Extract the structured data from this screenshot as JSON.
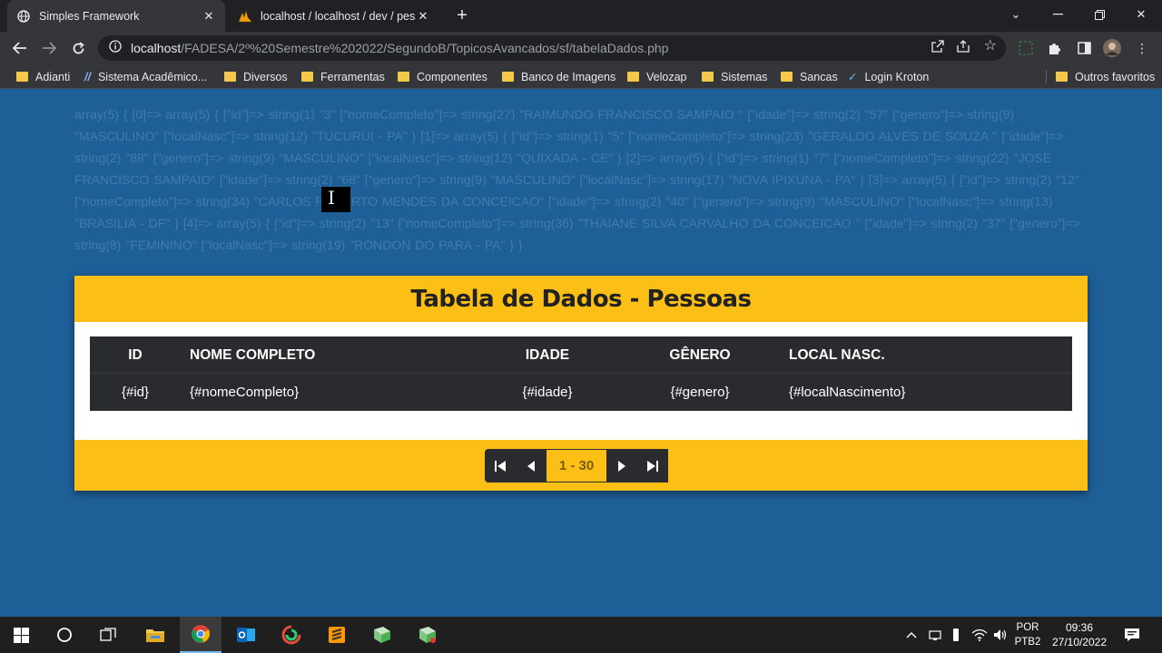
{
  "browser": {
    "tabs": [
      {
        "title": "Simples Framework",
        "icon": "globe-icon",
        "active": true
      },
      {
        "title": "localhost / localhost / dev / pessoas",
        "icon": "phpmyadmin-icon",
        "active": false
      }
    ],
    "url_host": "localhost",
    "url_path": "/FADESA/2º%20Semestre%202022/SegundoB/TopicosAvancados/sf/tabelaDados.php",
    "bookmarks": [
      {
        "label": "Adianti",
        "icon": "folder-icon"
      },
      {
        "label": "Sistema Acadêmico...",
        "icon": "slash-icon"
      },
      {
        "label": "Diversos",
        "icon": "folder-icon"
      },
      {
        "label": "Ferramentas",
        "icon": "folder-icon"
      },
      {
        "label": "Componentes",
        "icon": "folder-icon"
      },
      {
        "label": "Banco de Imagens",
        "icon": "folder-icon"
      },
      {
        "label": "Velozap",
        "icon": "folder-icon"
      },
      {
        "label": "Sistemas",
        "icon": "folder-icon"
      },
      {
        "label": "Sancas",
        "icon": "folder-icon"
      },
      {
        "label": "Login Kroton",
        "icon": "kroton-icon"
      }
    ],
    "other_bookmarks": "Outros favoritos"
  },
  "page": {
    "dump_text": "array(5) { [0]=> array(5) { [\"id\"]=> string(1) \"3\" [\"nomeCompleto\"]=> string(27) \"RAIMUNDO FRANCISCO SAMPAIO \" [\"idade\"]=> string(2) \"57\" [\"genero\"]=> string(9) \"MASCULINO\" [\"localNasc\"]=> string(12) \"TUCURUI - PA\" } [1]=> array(5) { [\"id\"]=> string(1) \"5\" [\"nomeCompleto\"]=> string(23) \"GERALDO ALVES DE SOUZA \" [\"idade\"]=> string(2) \"88\" [\"genero\"]=> string(9) \"MASCULINO\" [\"localNasc\"]=> string(12) \"QUIXADA - CE\" } [2]=> array(5) { [\"id\"]=> string(1) \"7\" [\"nomeCompleto\"]=> string(22) \"JOSE FRANCISCO SAMPAIO\" [\"idade\"]=> string(2) \"68\" [\"genero\"]=> string(9) \"MASCULINO\" [\"localNasc\"]=> string(17) \"NOVA IPIXUNA - PA\" } [3]=> array(5) { [\"id\"]=> string(2) \"12\" [\"nomeCompleto\"]=> string(34) \"CARLOS ROBERTO MENDES DA CONCEICAO\" [\"idade\"]=> string(2) \"40\" [\"genero\"]=> string(9) \"MASCULINO\" [\"localNasc\"]=> string(13) \"BRASILIA - DF\" } [4]=> array(5) { [\"id\"]=> string(2) \"13\" [\"nomeCompleto\"]=> string(36) \"THAIANE SILVA CARVALHO DA CONCEICAO \" [\"idade\"]=> string(2) \"37\" [\"genero\"]=> string(8) \"FEMININO\" [\"localNasc\"]=> string(19) \"RONDON DO PARA - PA\" } }",
    "card_title": "Tabela de Dados - Pessoas",
    "table": {
      "headers": {
        "id": "ID",
        "nome": "NOME COMPLETO",
        "idade": "IDADE",
        "genero": "GÊNERO",
        "local": "LOCAL NASC."
      },
      "row": {
        "id": "{#id}",
        "nome": "{#nomeCompleto}",
        "idade": "{#idade}",
        "genero": "{#genero}",
        "local": "{#localNascimento}"
      }
    },
    "pager_label": "1 - 30"
  },
  "taskbar": {
    "lang_line1": "POR",
    "lang_line2": "PTB2",
    "time": "09:36",
    "date": "27/10/2022"
  },
  "colors": {
    "page_bg": "#1e5f98",
    "accent_yellow": "#fcbf16",
    "table_dark": "#2a2b2e"
  }
}
